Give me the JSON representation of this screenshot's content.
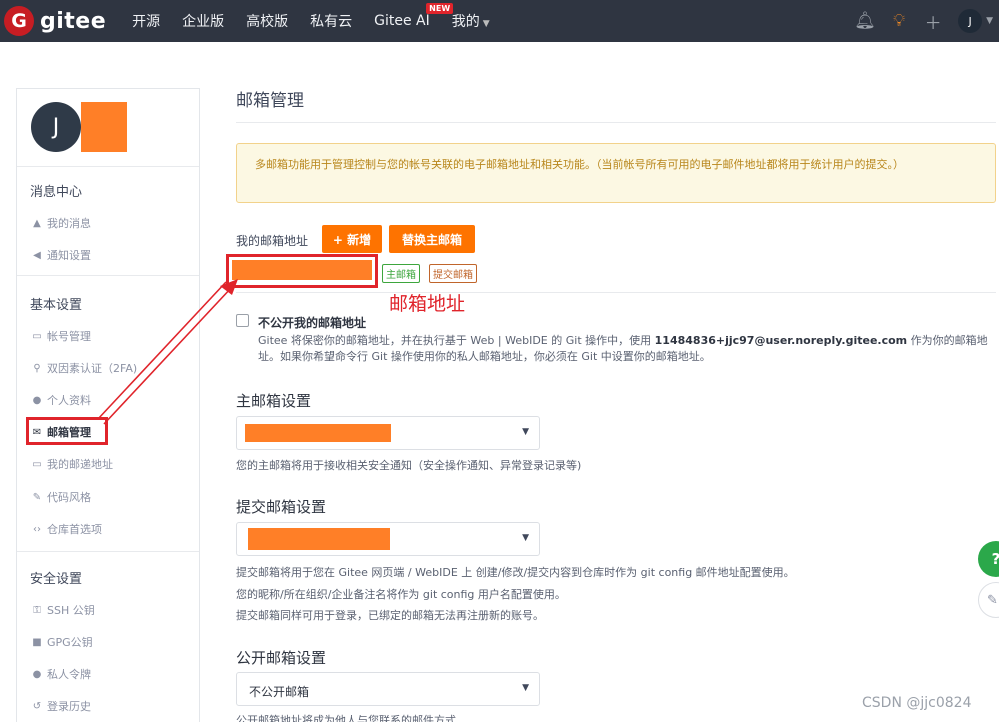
{
  "nav": {
    "logo_letter": "G",
    "logo_text": "gitee",
    "items": [
      "开源",
      "企业版",
      "高校版",
      "私有云",
      "Gitee AI",
      "我的"
    ],
    "new_badge": "NEW",
    "avatar_initial": "J"
  },
  "sidebar": {
    "avatar_initial": "J",
    "groups": {
      "messages": "消息中心",
      "basic": "基本设置",
      "security": "安全设置"
    },
    "items": {
      "my_messages": "我的消息",
      "notify_settings": "通知设置",
      "account": "帐号管理",
      "two_fa": "双因素认证（2FA)",
      "profile": "个人资料",
      "email": "邮箱管理",
      "address": "我的邮递地址",
      "code_style": "代码风格",
      "repo_prefs": "仓库首选项",
      "ssh": "SSH 公钥",
      "gpg": "GPG公钥",
      "token": "私人令牌",
      "login_history": "登录历史"
    }
  },
  "main": {
    "title": "邮箱管理",
    "notice": "多邮箱功能用于管理控制与您的帐号关联的电子邮箱地址和相关功能。（当前帐号所有可用的电子邮件地址都将用于统计用户的提交。）",
    "my_email_label": "我的邮箱地址",
    "add_button": "+ 新增",
    "replace_button": "替换主邮箱",
    "tag_primary": "主邮箱",
    "tag_commit": "提交邮箱",
    "annotation": "邮箱地址",
    "private_label": "不公开我的邮箱地址",
    "private_desc_1": "Gitee 将保密你的邮箱地址，并在执行基于 Web | WebIDE 的 Git 操作中，使用 ",
    "private_desc_email": "11484836+jjc97@user.noreply.gitee.com",
    "private_desc_2": " 作为你的邮箱地址。如果你希望命令行 Git 操作使用你的私人邮箱地址，你必须在 Git 中设置你的邮箱地址。",
    "primary_section": "主邮箱设置",
    "primary_help": "您的主邮箱将用于接收相关安全通知（安全操作通知、异常登录记录等)",
    "commit_section": "提交邮箱设置",
    "commit_help_1": "提交邮箱将用于您在 Gitee 网页端 / WebIDE 上 创建/修改/提交内容到仓库时作为 git config 邮件地址配置使用。",
    "commit_help_2": "您的昵称/所在组织/企业备注名将作为 git config 用户名配置使用。",
    "commit_help_3": "提交邮箱同样可用于登录，已绑定的邮箱无法再注册新的账号。",
    "public_section": "公开邮箱设置",
    "public_value": "不公开邮箱",
    "public_help": "公开邮箱地址将成为他人与您联系的邮件方式"
  },
  "float": {
    "help": "?"
  },
  "watermark": "CSDN @jjc0824",
  "colors": {
    "accent": "#fe7300",
    "brand": "#c71d23",
    "highlight": "#e0242b",
    "nav_bg": "#2f3541"
  }
}
